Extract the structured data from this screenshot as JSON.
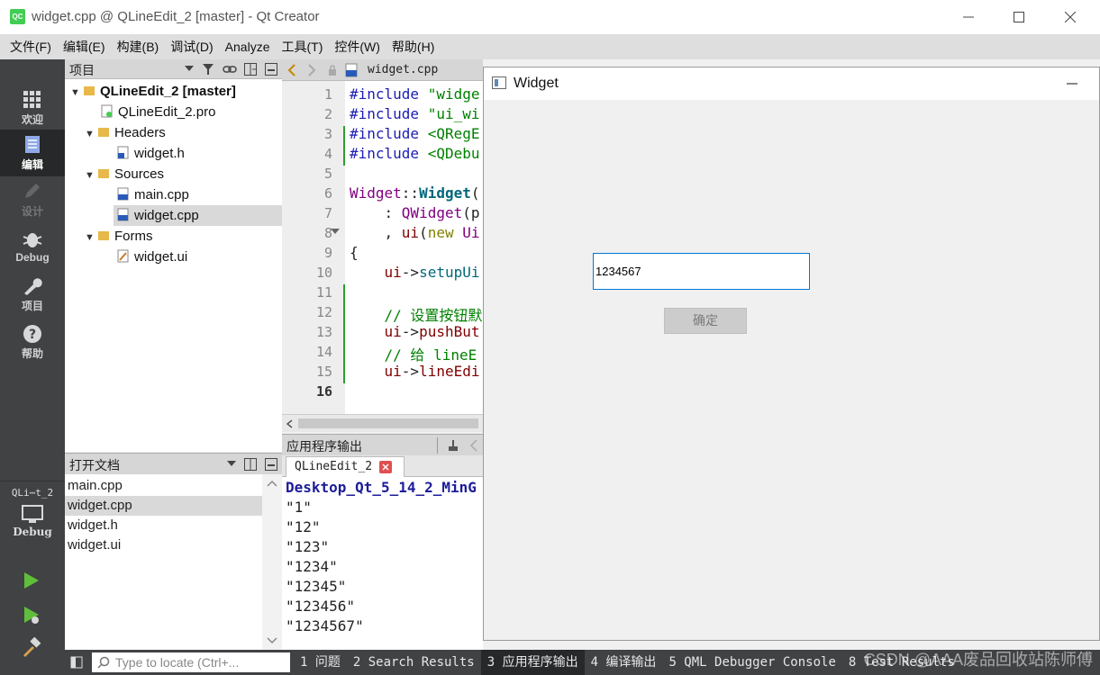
{
  "window": {
    "title": "widget.cpp @ QLineEdit_2 [master] - Qt Creator",
    "app_icon_text": "QC"
  },
  "menu": [
    "文件(F)",
    "编辑(E)",
    "构建(B)",
    "调试(D)",
    "Analyze",
    "工具(T)",
    "控件(W)",
    "帮助(H)"
  ],
  "modes": [
    {
      "label": "欢迎",
      "icon": "grid-icon"
    },
    {
      "label": "编辑",
      "icon": "edit-doc-icon"
    },
    {
      "label": "设计",
      "icon": "pencil-icon"
    },
    {
      "label": "Debug",
      "icon": "bug-icon"
    },
    {
      "label": "项目",
      "icon": "wrench-icon"
    },
    {
      "label": "帮助",
      "icon": "help-icon"
    }
  ],
  "kit": {
    "project": "QLi⋯t_2",
    "mode": "Debug"
  },
  "project_panel": {
    "title": "项目",
    "tree": [
      {
        "label": "QLineEdit_2 [master]",
        "level": 0
      },
      {
        "label": "QLineEdit_2.pro",
        "level": 1
      },
      {
        "label": "Headers",
        "level": 1
      },
      {
        "label": "widget.h",
        "level": 2
      },
      {
        "label": "Sources",
        "level": 1
      },
      {
        "label": "main.cpp",
        "level": 2
      },
      {
        "label": "widget.cpp",
        "level": 2
      },
      {
        "label": "Forms",
        "level": 1
      },
      {
        "label": "widget.ui",
        "level": 2
      }
    ]
  },
  "open_docs": {
    "title": "打开文档",
    "items": [
      "main.cpp",
      "widget.cpp",
      "widget.h",
      "widget.ui"
    ]
  },
  "editor": {
    "file_tab": "widget.cpp",
    "line_numbers": [
      "1",
      "2",
      "3",
      "4",
      "5",
      "6",
      "7",
      "8",
      "9",
      "10",
      "11",
      "12",
      "13",
      "14",
      "15",
      "16"
    ],
    "lines": [
      {
        "a": "#include ",
        "b": "\"widge"
      },
      {
        "a": "#include ",
        "b": "\"ui_wi"
      },
      {
        "a": "#include ",
        "b": "<QRegE"
      },
      {
        "a": "#include ",
        "b": "<QDebu"
      },
      {
        "a": "",
        "b": ""
      },
      {
        "a": "Widget",
        "b": "::",
        "c": "Widget",
        "d": "("
      },
      {
        "a": "    : ",
        "b": "QWidget",
        "c": "(p"
      },
      {
        "a": "    , ",
        "b": "ui",
        "c": "(",
        "d": "new ",
        "e": "Ui"
      },
      {
        "a": "{"
      },
      {
        "a": "    ",
        "b": "ui",
        "c": "->",
        "d": "setupUi"
      },
      {
        "a": ""
      },
      {
        "a": "    ",
        "b": "// 设置按钮默"
      },
      {
        "a": "    ",
        "b": "ui",
        "c": "->",
        "d": "pushBut"
      },
      {
        "a": "    ",
        "b": "// 给 lineE"
      },
      {
        "a": "    ",
        "b": "ui",
        "c": "->",
        "d": "lineEdi"
      },
      {
        "a": ""
      }
    ]
  },
  "output": {
    "title": "应用程序输出",
    "tab": "QLineEdit_2",
    "lines": [
      "Desktop_Qt_5_14_2_MinG",
      "\"1\"",
      "\"12\"",
      "\"123\"",
      "\"1234\"",
      "\"12345\"",
      "\"123456\"",
      "\"1234567\""
    ]
  },
  "statusbar": {
    "locator_placeholder": "Type to locate (Ctrl+...",
    "items": [
      "1 问题",
      "2 Search Results",
      "3 应用程序输出",
      "4 编译输出",
      "5 QML Debugger Console",
      "8 Test Results"
    ]
  },
  "widget_window": {
    "title": "Widget",
    "line_edit_value": "1234567",
    "button_label": "确定"
  },
  "watermark": "CSDN @AAA废品回收站陈师傅",
  "colors": {
    "accent": "#0078d7",
    "sidebar": "#404244",
    "active": "#262829"
  }
}
